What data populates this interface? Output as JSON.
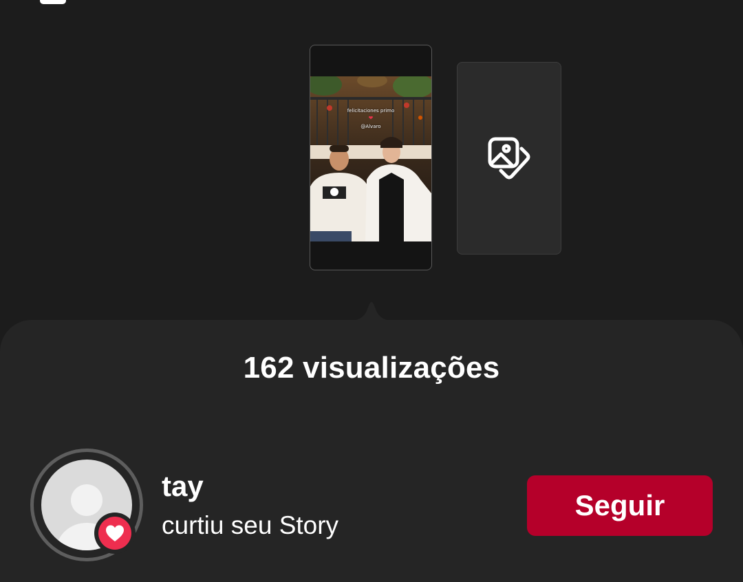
{
  "stories": {
    "current_story": {
      "caption_line_1": "felicitaciones primo",
      "caption_heart": "❤",
      "caption_mention": "@Alvaro"
    },
    "add_story_icon": "gallery-icon"
  },
  "sheet": {
    "views_label": "162 visualizações"
  },
  "activity": {
    "username": "tay",
    "action_text": "curtiu seu Story",
    "badge_icon": "heart-icon",
    "follow_label": "Seguir"
  },
  "colors": {
    "background": "#1c1c1c",
    "sheet": "#252525",
    "follow_button": "#b5002a",
    "like_badge": "#ee2e4f"
  }
}
